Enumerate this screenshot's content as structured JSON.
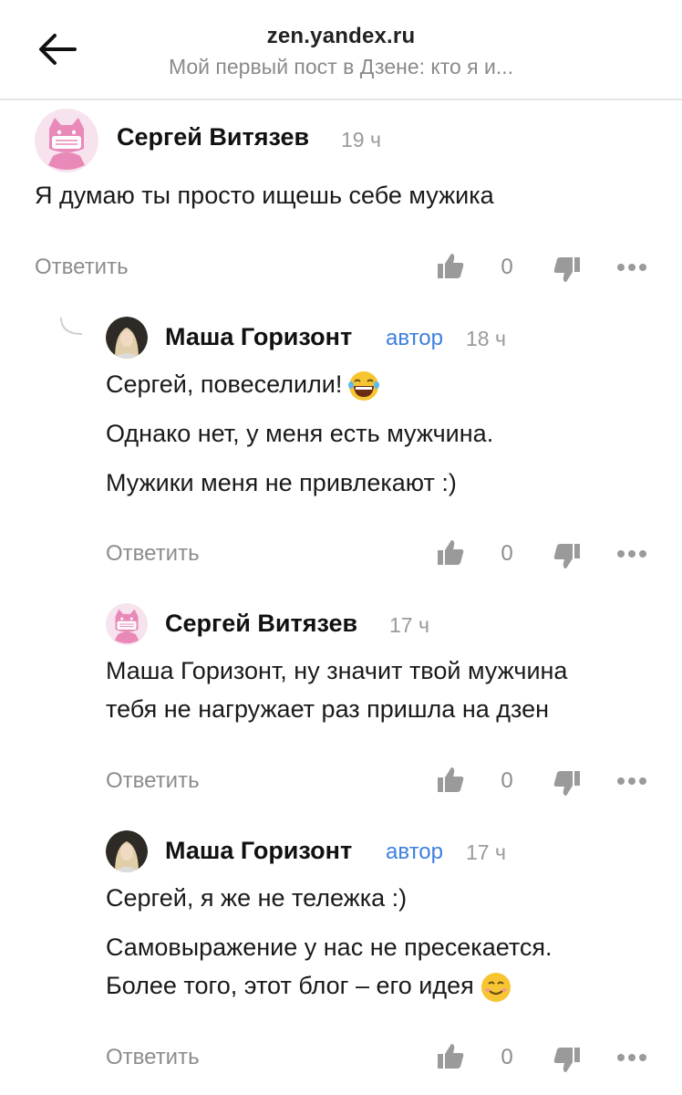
{
  "header": {
    "domain": "zen.yandex.ru",
    "title": "Мой первый пост в Дзене: кто я и..."
  },
  "actions": {
    "reply_label": "Ответить"
  },
  "comments": [
    {
      "author": "Сергей Витязев",
      "time": "19 ч",
      "lines": [
        "Я думаю ты просто ищешь себе мужика"
      ],
      "likes": "0"
    },
    {
      "author": "Маша Горизонт",
      "badge": "автор",
      "time": "18 ч",
      "lines": [
        "Сергей, повеселили!",
        "Однако нет, у меня есть мужчина.",
        "Мужики меня не привлекают :)"
      ],
      "likes": "0"
    },
    {
      "author": "Сергей Витязев",
      "time": "17 ч",
      "lines": [
        "Маша Горизонт, ну значит твой мужчина",
        "тебя не нагружает раз пришла на дзен"
      ],
      "likes": "0"
    },
    {
      "author": "Маша Горизонт",
      "badge": "автор",
      "time": "17 ч",
      "lines": [
        "Сергей, я же не тележка :)",
        "Самовыражение у нас не пресекается.",
        "Более того, этот блог – его идея"
      ],
      "likes": "0"
    }
  ],
  "colors": {
    "author_badge": "#3d7fe0",
    "muted": "#8c8c8c",
    "avatar_pink": "#e889b8",
    "avatar_bg": "#f6e3ee"
  },
  "icons": [
    "back-arrow-icon",
    "thumb-up-icon",
    "thumb-down-icon",
    "more-dots-icon",
    "laughing-emoji-icon",
    "smiling-emoji-icon",
    "reply-thread-icon"
  ]
}
